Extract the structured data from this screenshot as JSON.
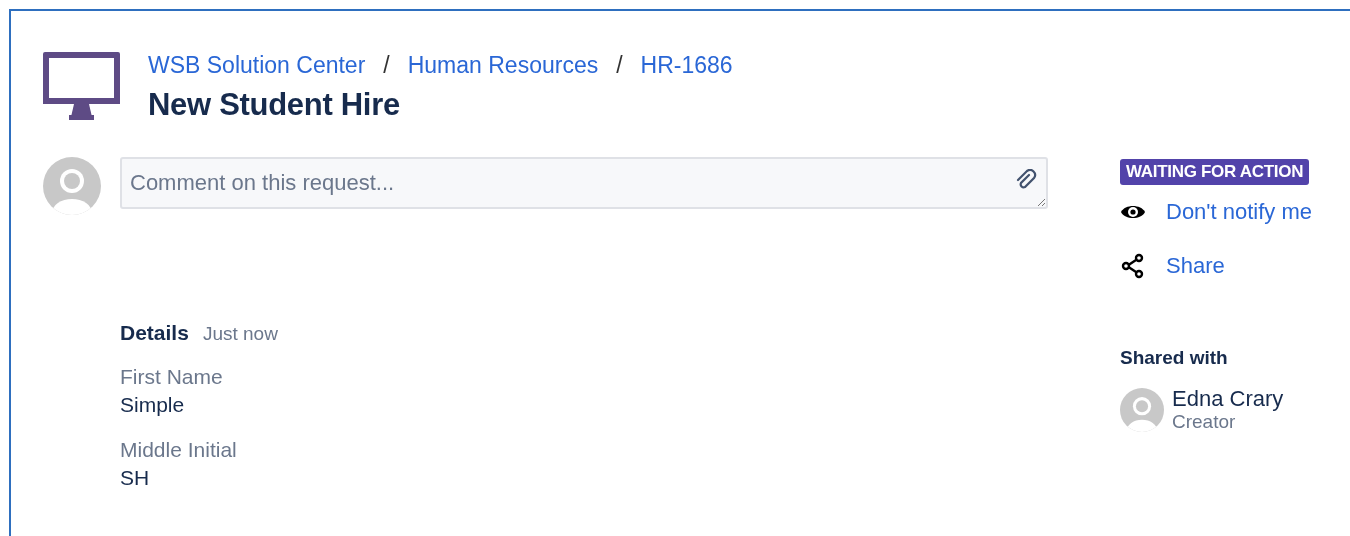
{
  "breadcrumb": [
    {
      "kind": "link",
      "label": "WSB Solution Center"
    },
    {
      "kind": "separator",
      "label": "/"
    },
    {
      "kind": "link",
      "label": "Human Resources"
    },
    {
      "kind": "separator",
      "label": "/"
    },
    {
      "kind": "link",
      "label": "HR-1686"
    }
  ],
  "title": "New Student Hire",
  "comment": {
    "placeholder": "Comment on this request..."
  },
  "details": {
    "heading": "Details",
    "time": "Just now",
    "fields": [
      {
        "label": "First Name",
        "value": "Simple"
      },
      {
        "label": "Middle Initial",
        "value": "SH"
      }
    ]
  },
  "status": {
    "label": "WAITING FOR ACTION"
  },
  "actions": [
    {
      "kind": "watch",
      "label": "Don't notify me"
    },
    {
      "kind": "share",
      "label": "Share"
    }
  ],
  "shared_with": {
    "heading": "Shared with",
    "people": [
      {
        "name": "Edna Crary",
        "role": "Creator"
      }
    ]
  }
}
